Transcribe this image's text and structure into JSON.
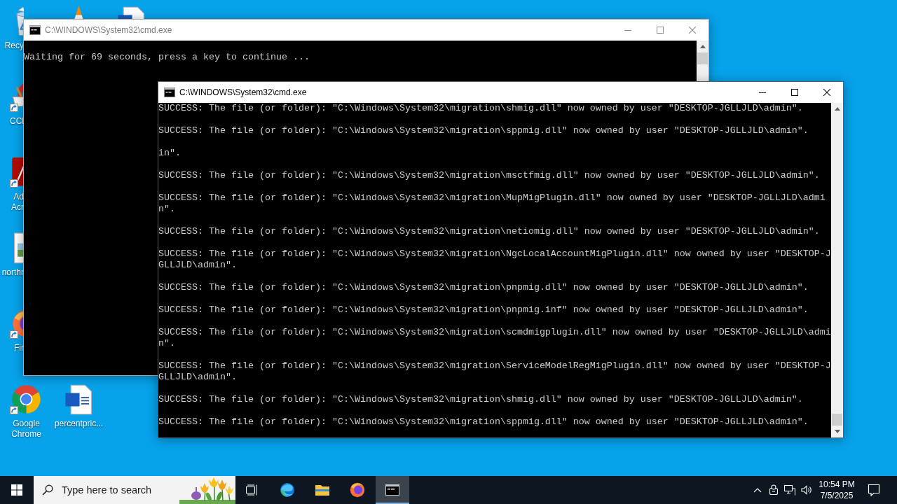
{
  "desktop": {
    "icons": [
      {
        "kind": "recycle",
        "label": "Recy",
        "shortcut": false
      },
      {
        "kind": "cleaner",
        "label": "CCl",
        "shortcut": true
      },
      {
        "kind": "pdf",
        "label": "Ad Acr",
        "shortcut": true
      },
      {
        "kind": "image",
        "label": "northr",
        "shortcut": false
      },
      {
        "kind": "firefox",
        "label": "Fir",
        "shortcut": true
      },
      {
        "kind": "chrome",
        "label": "Google Chrome",
        "shortcut": true
      },
      {
        "kind": "cone"
      },
      {
        "kind": "word"
      },
      {
        "kind": "word",
        "label": "percentpric...",
        "shortcut": false
      }
    ]
  },
  "windows": [
    {
      "title": "C:\\WINDOWS\\System32\\cmd.exe",
      "active": false,
      "output": [
        "Waiting for 69 seconds, press a key to continue ..."
      ]
    },
    {
      "title": "C:\\WINDOWS\\System32\\cmd.exe",
      "active": true,
      "output": [
        "SUCCESS: The file (or folder): \"C:\\Windows\\System32\\migration\\shmig.dll\" now owned by user \"DESKTOP-JGLLJLD\\admin\".",
        "SUCCESS: The file (or folder): \"C:\\Windows\\System32\\migration\\sppmig.dll\" now owned by user \"DESKTOP-JGLLJLD\\admin\".",
        "in\".",
        "SUCCESS: The file (or folder): \"C:\\Windows\\System32\\migration\\msctfmig.dll\" now owned by user \"DESKTOP-JGLLJLD\\admin\".",
        "SUCCESS: The file (or folder): \"C:\\Windows\\System32\\migration\\MupMigPlugin.dll\" now owned by user \"DESKTOP-JGLLJLD\\admin\".",
        "SUCCESS: The file (or folder): \"C:\\Windows\\System32\\migration\\netiomig.dll\" now owned by user \"DESKTOP-JGLLJLD\\admin\".",
        "SUCCESS: The file (or folder): \"C:\\Windows\\System32\\migration\\NgcLocalAccountMigPlugin.dll\" now owned by user \"DESKTOP-JGLLJLD\\admin\".",
        "SUCCESS: The file (or folder): \"C:\\Windows\\System32\\migration\\pnpmig.dll\" now owned by user \"DESKTOP-JGLLJLD\\admin\".",
        "SUCCESS: The file (or folder): \"C:\\Windows\\System32\\migration\\pnpmig.inf\" now owned by user \"DESKTOP-JGLLJLD\\admin\".",
        "SUCCESS: The file (or folder): \"C:\\Windows\\System32\\migration\\scmdmigplugin.dll\" now owned by user \"DESKTOP-JGLLJLD\\admin\".",
        "SUCCESS: The file (or folder): \"C:\\Windows\\System32\\migration\\ServiceModelRegMigPlugin.dll\" now owned by user \"DESKTOP-JGLLJLD\\admin\".",
        "SUCCESS: The file (or folder): \"C:\\Windows\\System32\\migration\\shmig.dll\" now owned by user \"DESKTOP-JGLLJLD\\admin\".",
        "SUCCESS: The file (or folder): \"C:\\Windows\\System32\\migration\\sppmig.dll\" now owned by user \"DESKTOP-JGLLJLD\\admin\"."
      ]
    }
  ],
  "taskbar": {
    "search": {
      "placeholder": "Type here to search"
    },
    "apps": [
      {
        "kind": "edge",
        "active": false
      },
      {
        "kind": "explorer",
        "active": false
      },
      {
        "kind": "firefox",
        "active": false
      },
      {
        "kind": "console",
        "active": true
      }
    ],
    "clock": {
      "time": "10:54 PM",
      "date": "7/5/2025"
    }
  }
}
